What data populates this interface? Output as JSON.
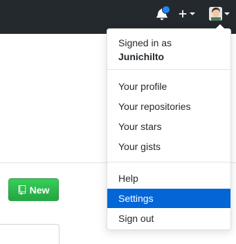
{
  "header": {
    "notification_icon": "bell-icon",
    "create_icon": "plus-icon",
    "avatar_icon": "avatar"
  },
  "main": {
    "new_button_label": "New",
    "new_button_icon": "book-icon"
  },
  "dropdown": {
    "signed_in_label": "Signed in as",
    "username": "Junichilto",
    "items_group1": [
      {
        "label": "Your profile"
      },
      {
        "label": "Your repositories"
      },
      {
        "label": "Your stars"
      },
      {
        "label": "Your gists"
      }
    ],
    "items_group2": [
      {
        "label": "Help"
      },
      {
        "label": "Settings",
        "active": true
      },
      {
        "label": "Sign out"
      }
    ]
  },
  "colors": {
    "header_bg": "#24292e",
    "accent": "#0366d6",
    "new_button": "#28a745",
    "notification_dot": "#2188ff"
  }
}
